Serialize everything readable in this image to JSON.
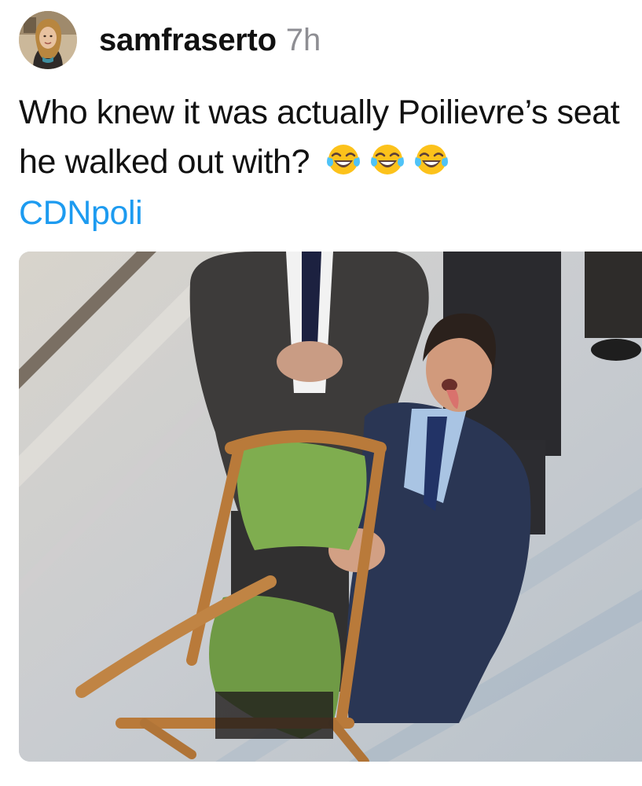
{
  "post": {
    "author": {
      "handle": "samfraserto",
      "avatar_icon": "avatar-photo"
    },
    "time": "7h",
    "text": "Who knew it was actually Poilievre’s seat he walked out with?",
    "emoji": [
      "😂",
      "😂",
      "😂"
    ],
    "emoji_icon": "face-with-tears-of-joy-icon",
    "hashtag": "CDNpoli",
    "media": {
      "type": "photo"
    }
  },
  "colors": {
    "link": "#1d9bf0",
    "timestamp": "#8e8e93",
    "text": "#111111"
  }
}
